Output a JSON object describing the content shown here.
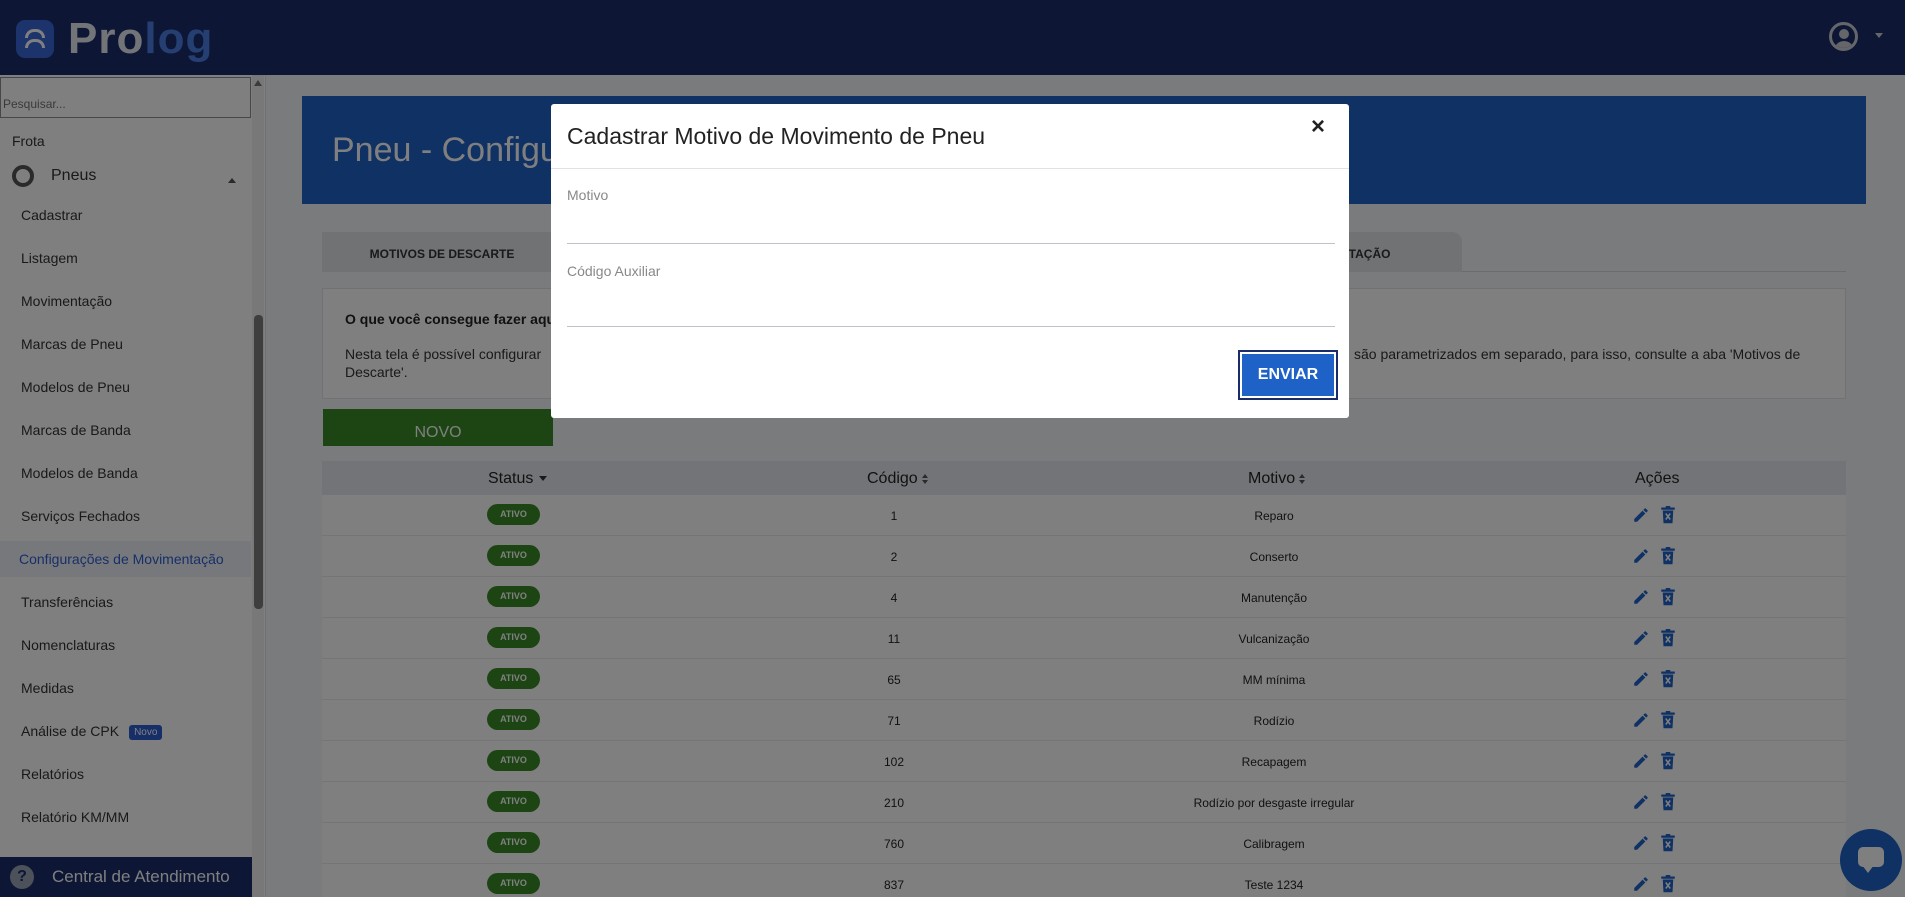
{
  "app": {
    "logo_part1": "Pro",
    "logo_part2": "log"
  },
  "sidebar": {
    "search_placeholder": "Pesquisar...",
    "section": "Frota",
    "group": "Pneus",
    "items": [
      {
        "label": "Cadastrar"
      },
      {
        "label": "Listagem"
      },
      {
        "label": "Movimentação"
      },
      {
        "label": "Marcas de Pneu"
      },
      {
        "label": "Modelos de Pneu"
      },
      {
        "label": "Marcas de Banda"
      },
      {
        "label": "Modelos de Banda"
      },
      {
        "label": "Serviços Fechados"
      },
      {
        "label": "Configurações de Movimentação"
      },
      {
        "label": "Transferências"
      },
      {
        "label": "Nomenclaturas"
      },
      {
        "label": "Medidas"
      },
      {
        "label": "Análise de CPK",
        "badge": "Novo"
      },
      {
        "label": "Relatórios"
      },
      {
        "label": "Relatório KM/MM"
      }
    ],
    "help_label": "Central de Atendimento"
  },
  "main": {
    "title": "Pneu - Configura",
    "tabs": [
      {
        "label": "MOTIVOS DE DESCARTE"
      },
      {
        "label": "ENTAÇÃO"
      }
    ],
    "info": {
      "title": "O que você consegue fazer aqui",
      "text_left": "Nesta tela é possível configurar Descarte'.",
      "text_right": "são parametrizados em separado, para isso, consulte a aba 'Motivos de"
    },
    "new_button": "NOVO",
    "table": {
      "headers": {
        "status": "Status",
        "codigo": "Código",
        "motivo": "Motivo",
        "acoes": "Ações"
      },
      "rows": [
        {
          "status": "ATIVO",
          "codigo": "1",
          "motivo": "Reparo"
        },
        {
          "status": "ATIVO",
          "codigo": "2",
          "motivo": "Conserto"
        },
        {
          "status": "ATIVO",
          "codigo": "4",
          "motivo": "Manutenção"
        },
        {
          "status": "ATIVO",
          "codigo": "11",
          "motivo": "Vulcanização"
        },
        {
          "status": "ATIVO",
          "codigo": "65",
          "motivo": "MM mínima"
        },
        {
          "status": "ATIVO",
          "codigo": "71",
          "motivo": "Rodízio"
        },
        {
          "status": "ATIVO",
          "codigo": "102",
          "motivo": "Recapagem"
        },
        {
          "status": "ATIVO",
          "codigo": "210",
          "motivo": "Rodízio por desgaste irregular"
        },
        {
          "status": "ATIVO",
          "codigo": "760",
          "motivo": "Calibragem"
        },
        {
          "status": "ATIVO",
          "codigo": "837",
          "motivo": "Teste 1234"
        }
      ]
    }
  },
  "modal": {
    "title": "Cadastrar Motivo de Movimento de Pneu",
    "close": "×",
    "fields": {
      "motivo": {
        "label": "Motivo",
        "value": ""
      },
      "codigo": {
        "label": "Código Auxiliar",
        "value": ""
      }
    },
    "submit": "ENVIAR"
  },
  "colors": {
    "topbar": "#1a2d6b",
    "primary": "#1e62c8",
    "success": "#3a8a28",
    "active_link": "#2f5fd2"
  },
  "icons": [
    "user-avatar-icon",
    "tire-icon",
    "help-icon",
    "edit-icon",
    "delete-icon",
    "chat-icon",
    "close-icon"
  ]
}
